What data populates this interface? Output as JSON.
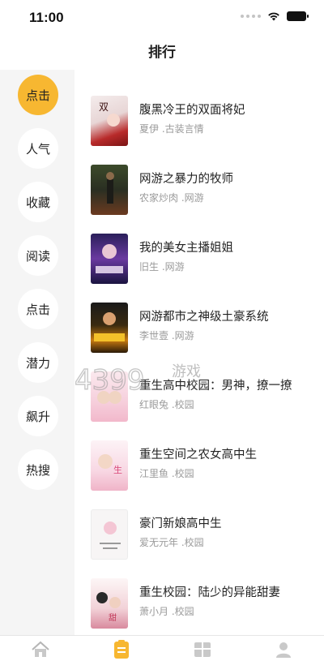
{
  "status_bar": {
    "time": "11:00"
  },
  "header": {
    "title": "排行"
  },
  "sidebar": {
    "items": [
      {
        "label": "点击",
        "active": true
      },
      {
        "label": "人气",
        "active": false
      },
      {
        "label": "收藏",
        "active": false
      },
      {
        "label": "阅读",
        "active": false
      },
      {
        "label": "点击",
        "active": false
      },
      {
        "label": "潜力",
        "active": false
      },
      {
        "label": "飙升",
        "active": false
      },
      {
        "label": "热搜",
        "active": false
      }
    ]
  },
  "books": [
    {
      "title": "腹黑冷王的双面将妃",
      "meta": "夏伊 .古装言情"
    },
    {
      "title": "网游之暴力的牧师",
      "meta": "农家炒肉 .网游"
    },
    {
      "title": "我的美女主播姐姐",
      "meta": "旧生 .网游"
    },
    {
      "title": "网游都市之神级土豪系统",
      "meta": "李世壹 .网游"
    },
    {
      "title": "重生高中校园：男神，撩一撩",
      "meta": "红眼兔 .校园"
    },
    {
      "title": "重生空间之农女高中生",
      "meta": "江里鱼 .校园"
    },
    {
      "title": "豪门新娘高中生",
      "meta": "爱无元年 .校园"
    },
    {
      "title": "重生校园：陆少的异能甜妻",
      "meta": "萧小月 .校园"
    }
  ],
  "watermark": {
    "text": "游戏"
  },
  "colors": {
    "accent": "#f7b731",
    "sidebar_bg": "#f5f5f5",
    "meta_text": "#9a9a9a"
  },
  "tab_bar": {
    "tabs": [
      {
        "icon": "home-icon",
        "active": false
      },
      {
        "icon": "bookshelf-icon",
        "active": true
      },
      {
        "icon": "category-icon",
        "active": false
      },
      {
        "icon": "profile-icon",
        "active": false
      }
    ]
  }
}
